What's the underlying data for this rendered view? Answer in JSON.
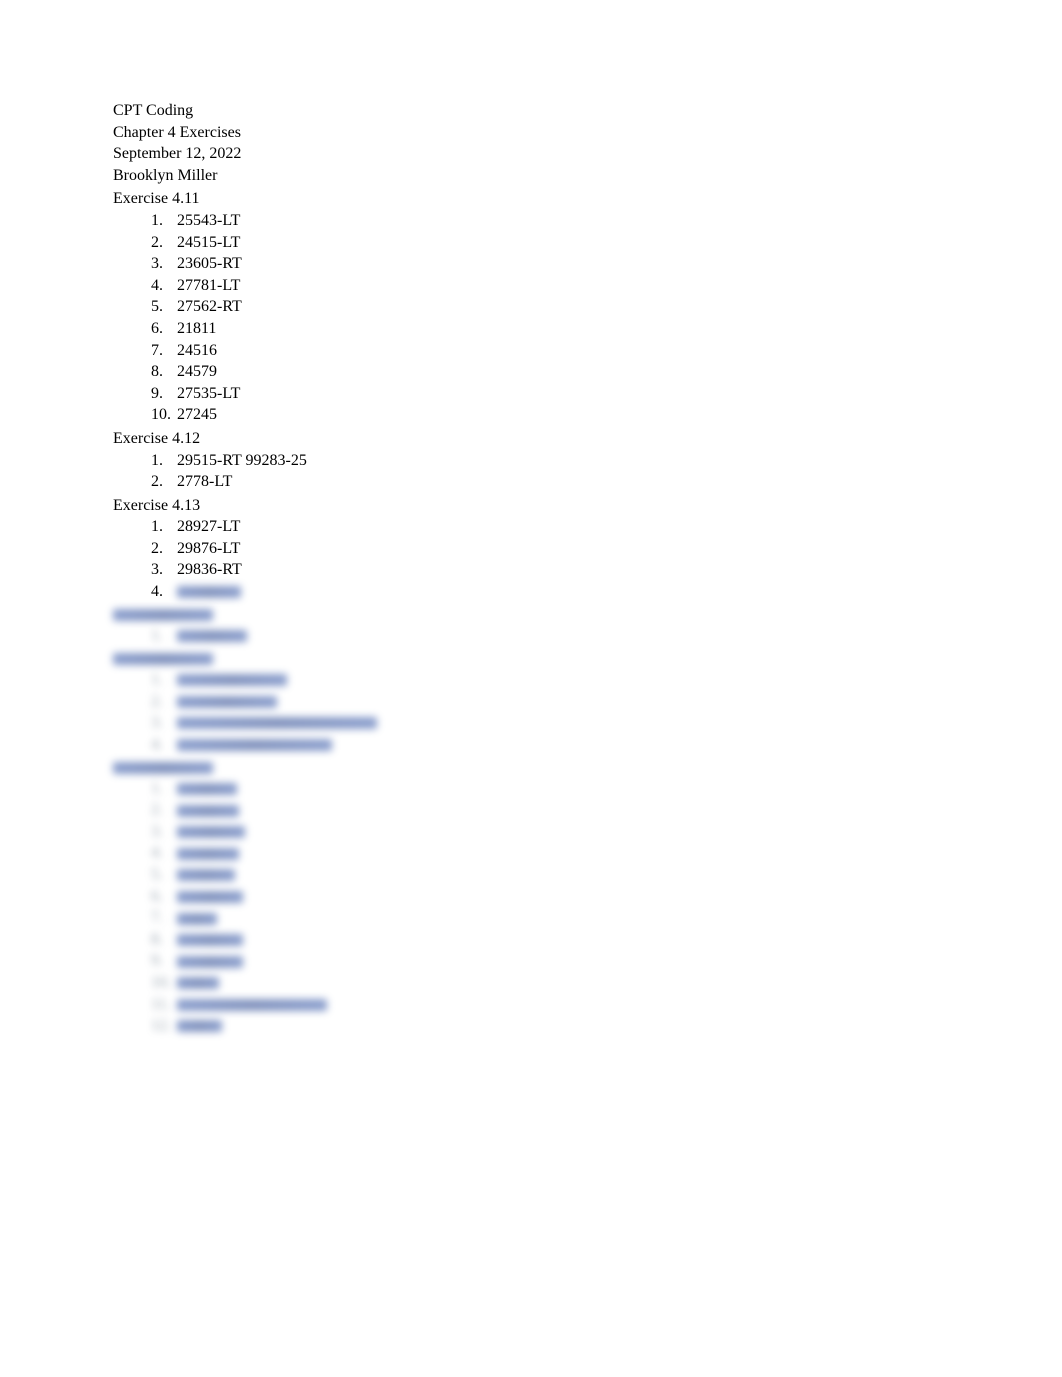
{
  "header": {
    "course": "CPT Coding",
    "chapter": "Chapter 4 Exercises",
    "date": "September 12, 2022",
    "name": "Brooklyn Miller"
  },
  "sections": [
    {
      "title": "Exercise 4.11",
      "items": [
        "25543-LT",
        "24515-LT",
        "23605-RT",
        "27781-LT",
        "27562-RT",
        "21811",
        "24516",
        "24579",
        "27535-LT",
        "27245"
      ]
    },
    {
      "title": "Exercise 4.12",
      "items": [
        "29515-RT  99283-25",
        "2778-LT"
      ]
    },
    {
      "title": "Exercise 4.13",
      "items": [
        "28927-LT",
        "29876-LT",
        "29836-RT"
      ]
    }
  ],
  "blurred": {
    "ex413_item4_num": "4.",
    "sections": [
      {
        "item_count": 1,
        "widths": [
          70
        ]
      },
      {
        "item_count": 4,
        "widths": [
          110,
          100,
          200,
          155
        ]
      },
      {
        "item_count": 12,
        "widths": [
          60,
          62,
          68,
          62,
          58,
          66,
          40,
          66,
          66,
          42,
          150,
          45
        ]
      }
    ]
  }
}
